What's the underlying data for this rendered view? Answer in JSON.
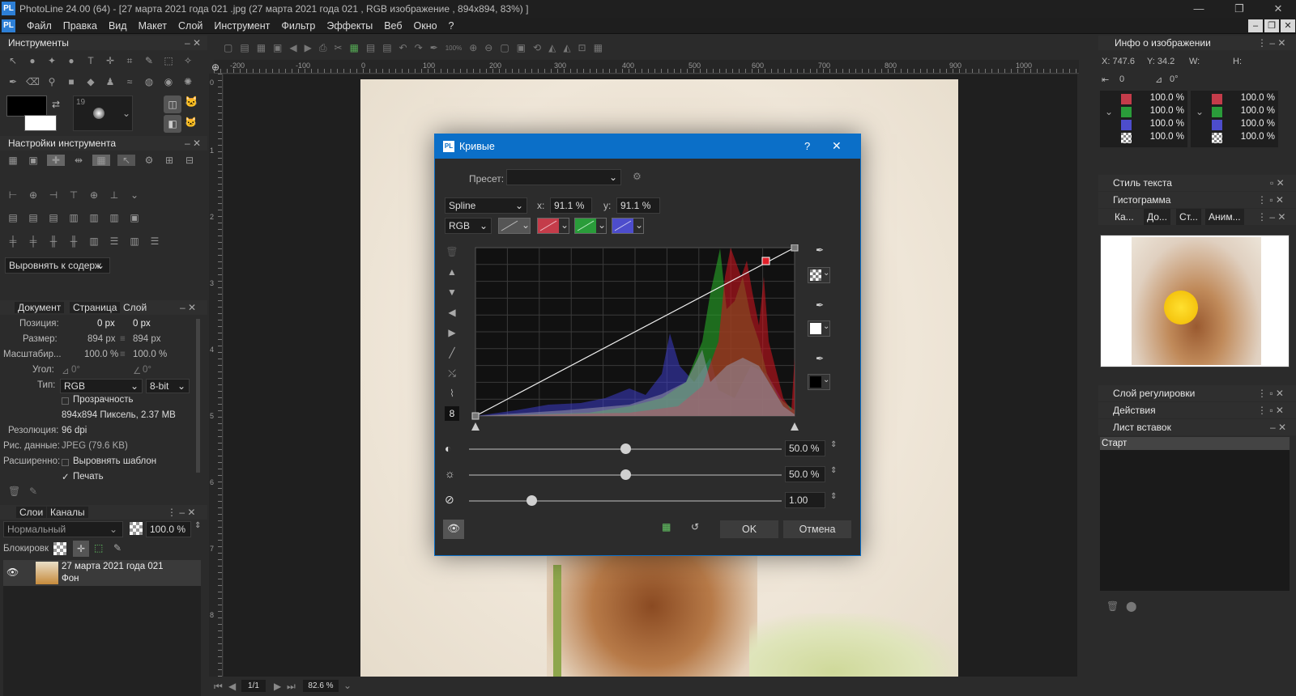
{
  "window": {
    "title": "PhotoLine 24.00 (64) - [27 марта 2021 года 021 .jpg (27 марта 2021 года 021 , RGB изображение , 894x894, 83%) ]",
    "logo": "PL"
  },
  "menubar": {
    "items": [
      "Файл",
      "Правка",
      "Вид",
      "Макет",
      "Слой",
      "Инструмент",
      "Фильтр",
      "Эффекты",
      "Веб",
      "Окно",
      "?"
    ]
  },
  "left": {
    "tools_title": "Инструменты",
    "brush_size": "19",
    "tool_settings_title": "Настройки инструмента",
    "align_dropdown": "Выровнять к содерж",
    "doc_tabs": [
      "Документ",
      "Страница",
      "Слой"
    ],
    "doc": {
      "position_label": "Позиция:",
      "position_x": "0 px",
      "position_y": "0 px",
      "size_label": "Размер:",
      "size_w": "894 px",
      "size_h": "894 px",
      "scale_label": "Масштабир...",
      "scale_x": "100.0 %",
      "scale_y": "100.0 %",
      "angle_label": "Угол:",
      "angle1": "0°",
      "angle2": "0°",
      "type_label": "Тип:",
      "type_value": "RGB",
      "bit_value": "8-bit",
      "transparency": "Прозрачность",
      "info": "894x894 Пиксель, 2.37 MB",
      "resolution_label": "Резолюция:",
      "resolution_value": "96 dpi",
      "picdata_label": "Рис. данные:",
      "picdata_value": "JPEG (79.6 KB)",
      "extended_label": "Расширенно:",
      "align_template": "Выровнять шаблон",
      "print": "Печать",
      "print_check": "✓"
    },
    "layers_tabs": [
      "Слои",
      "Каналы"
    ],
    "blend_mode": "Нормальный",
    "opacity": "100.0 %",
    "lock_label": "Блокировк",
    "layer": {
      "name": "27 марта 2021 года 021",
      "sub": "Фон"
    }
  },
  "toolbar": {
    "zoom_label": "100%"
  },
  "ruler": {
    "h_ticks": [
      "-200",
      "-100",
      "0",
      "100",
      "200",
      "300",
      "400",
      "500",
      "600",
      "700",
      "800",
      "900",
      "1000"
    ],
    "v_ticks": [
      "0",
      "1",
      "2",
      "3",
      "4",
      "5",
      "6",
      "7",
      "8"
    ]
  },
  "status": {
    "page": "1/1",
    "zoom": "82.6 %"
  },
  "dialog": {
    "logo": "PL",
    "title": "Кривые",
    "help": "?",
    "close": "✕",
    "preset_label": "Пресет:",
    "preset_value": "",
    "interp": "Spline",
    "x_label": "x:",
    "x_value": "91.1 %",
    "y_label": "y:",
    "y_value": "91.1 %",
    "channel": "RGB",
    "side_num": "8",
    "contrast_value": "50.0 %",
    "brightness_value": "50.0 %",
    "gamma_value": "1.00",
    "ok": "OK",
    "cancel": "Отмена",
    "contrast_level": 0.5,
    "brightness_level": 0.5,
    "gamma_level": 0.2,
    "colors": {
      "accent": "#0b6fc8",
      "red": "#c43c4a",
      "green": "#2a9c3a",
      "blue": "#4d4dcc"
    }
  },
  "right": {
    "info_title": "Инфо о изображении",
    "coords": {
      "x": "X: 747.6",
      "y": "Y: 34.2",
      "w": "W:",
      "h": "H:"
    },
    "dist": "0",
    "angle": "0°",
    "channels_left": [
      "100.0 %",
      "100.0 %",
      "100.0 %",
      "100.0 %"
    ],
    "channels_right": [
      "100.0 %",
      "100.0 %",
      "100.0 %",
      "100.0 %"
    ],
    "text_style_title": "Стиль текста",
    "histogram_title": "Гистограмма",
    "tabs": [
      "Ка...",
      "До...",
      "Ст...",
      "Аним..."
    ],
    "adjust_title": "Слой регулировки",
    "actions_title": "Действия",
    "clipboard_title": "Лист вставок",
    "clipboard_item": "Старт"
  }
}
